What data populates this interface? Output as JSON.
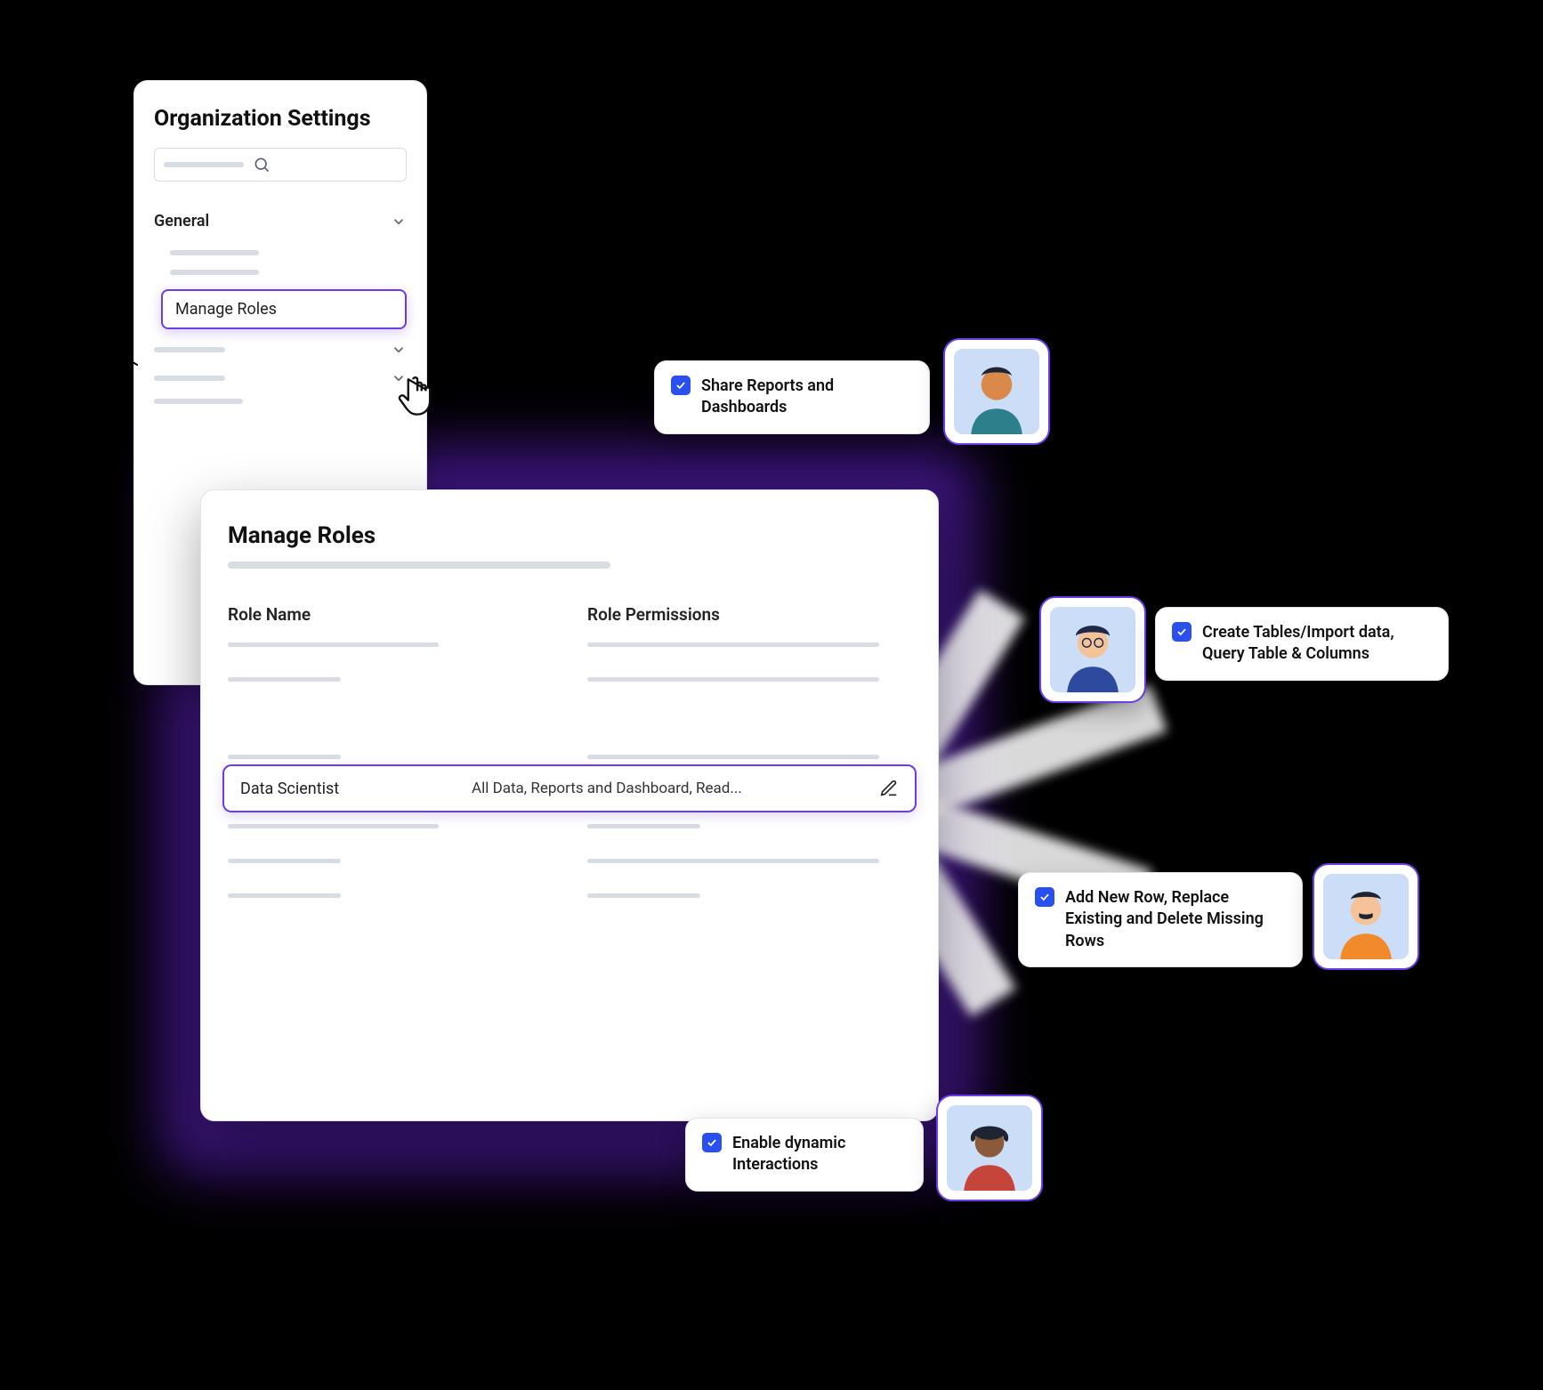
{
  "sidebar": {
    "title": "Organization Settings",
    "search_placeholder": "Search",
    "sections": {
      "general": {
        "label": "General"
      },
      "manage_roles": {
        "label": "Manage Roles"
      }
    }
  },
  "main": {
    "title": "Manage Roles",
    "columns": {
      "name": "Role Name",
      "perms": "Role Permissions"
    },
    "selected_role": {
      "name": "Data Scientist",
      "permissions": "All Data, Reports and Dashboard, Read..."
    }
  },
  "callouts": {
    "c1": {
      "text": "Share Reports and Dashboards",
      "checked": true
    },
    "c2": {
      "text": "Create Tables/Import data, Query Table & Columns",
      "checked": true
    },
    "c3": {
      "text": "Add New Row, Replace Existing and Delete Missing Rows",
      "checked": true
    },
    "c4": {
      "text": "Enable dynamic Interactions",
      "checked": true
    }
  },
  "colors": {
    "accent": "#6A3DE8",
    "checkbox": "#2950EE",
    "avatar_bg": "#CBDDF7"
  }
}
